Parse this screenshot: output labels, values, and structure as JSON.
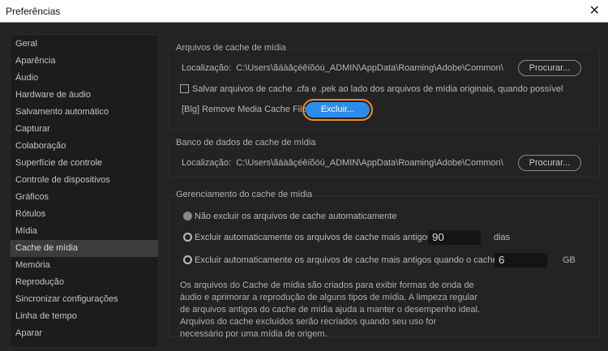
{
  "window": {
    "title": "Preferências",
    "close": "✕"
  },
  "sidebar": {
    "items": [
      "Geral",
      "Aparência",
      "Áudio",
      "Hardware de áudio",
      "Salvamento automático",
      "Capturar",
      "Colaboração",
      "Superfície de controle",
      "Controle de dispositivos",
      "Gráficos",
      "Rótulos",
      "Mídia",
      "Cache de mídia",
      "Memória",
      "Reprodução",
      "Sincronizar configurações",
      "Linha de tempo",
      "Aparar"
    ],
    "selected": "Cache de mídia"
  },
  "cache_files": {
    "title": "Arquivos de cache de mídia",
    "location_label": "Localização:",
    "location": "C:\\Users\\ãáàâçéêíõóú_ADMIN\\AppData\\Roaming\\Adobe\\Common\\",
    "browse": "Procurar...",
    "save_side": "Salvar arquivos de cache .cfa e .pek ao lado dos arquivos de mídia originais, quando possível",
    "remove_label": "[Blg] Remove Media Cache Files",
    "delete": "Excluir..."
  },
  "cache_db": {
    "title": "Banco de dados de cache de mídia",
    "location_label": "Localização:",
    "location": "C:\\Users\\ãáàâçéêíõóú_ADMIN\\AppData\\Roaming\\Adobe\\Common\\",
    "browse": "Procurar..."
  },
  "management": {
    "title": "Gerenciamento do cache de mídia",
    "opt1": "Não excluir os arquivos de cache automaticamente",
    "opt2": "Excluir automaticamente os arquivos de cache mais antigos que:",
    "days": "90",
    "days_unit": "dias",
    "opt3": "Excluir automaticamente os arquivos de cache mais antigos quando o cache exceder:",
    "size": "6",
    "size_unit": "GB",
    "description": "Os arquivos do Cache de mídia são criados para exibir formas de onda de áudio e aprimorar a reprodução de alguns tipos de mídia.  A limpeza regular de arquivos antigos do cache de mídia ajuda a manter o desempenho ideal. Arquivos do cache excluídos serão recriados quando seu uso for necessário por uma mídia de origem."
  }
}
